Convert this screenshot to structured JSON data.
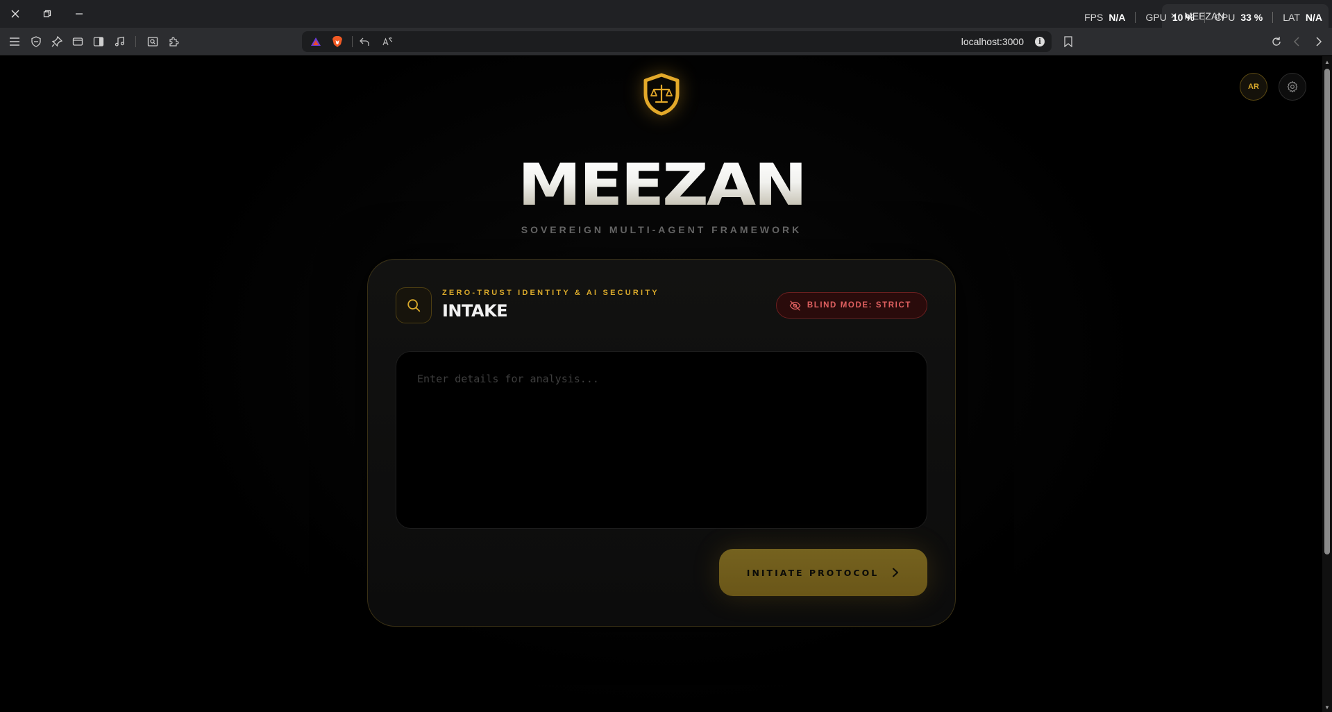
{
  "browser": {
    "tab_title": "MEEZAN",
    "url": "localhost:3000",
    "stats": {
      "fps_label": "FPS",
      "fps_value": "N/A",
      "gpu_label": "GPU",
      "gpu_value": "10 %",
      "cpu_label": "CPU",
      "cpu_value": "33 %",
      "lat_label": "LAT",
      "lat_value": "N/A"
    }
  },
  "header": {
    "lang_label": "AR",
    "brand_title": "MEEZAN",
    "tagline": "SOVEREIGN MULTI-AGENT FRAMEWORK"
  },
  "card": {
    "kicker": "ZERO-TRUST IDENTITY & AI SECURITY",
    "title": "INTAKE",
    "badge_label": "BLIND MODE: STRICT",
    "input_placeholder": "Enter details for analysis...",
    "cta_label": "INITIATE PROTOCOL"
  },
  "colors": {
    "accent_gold": "#d9a92b",
    "danger_red": "#e06060",
    "background": "#000000"
  }
}
